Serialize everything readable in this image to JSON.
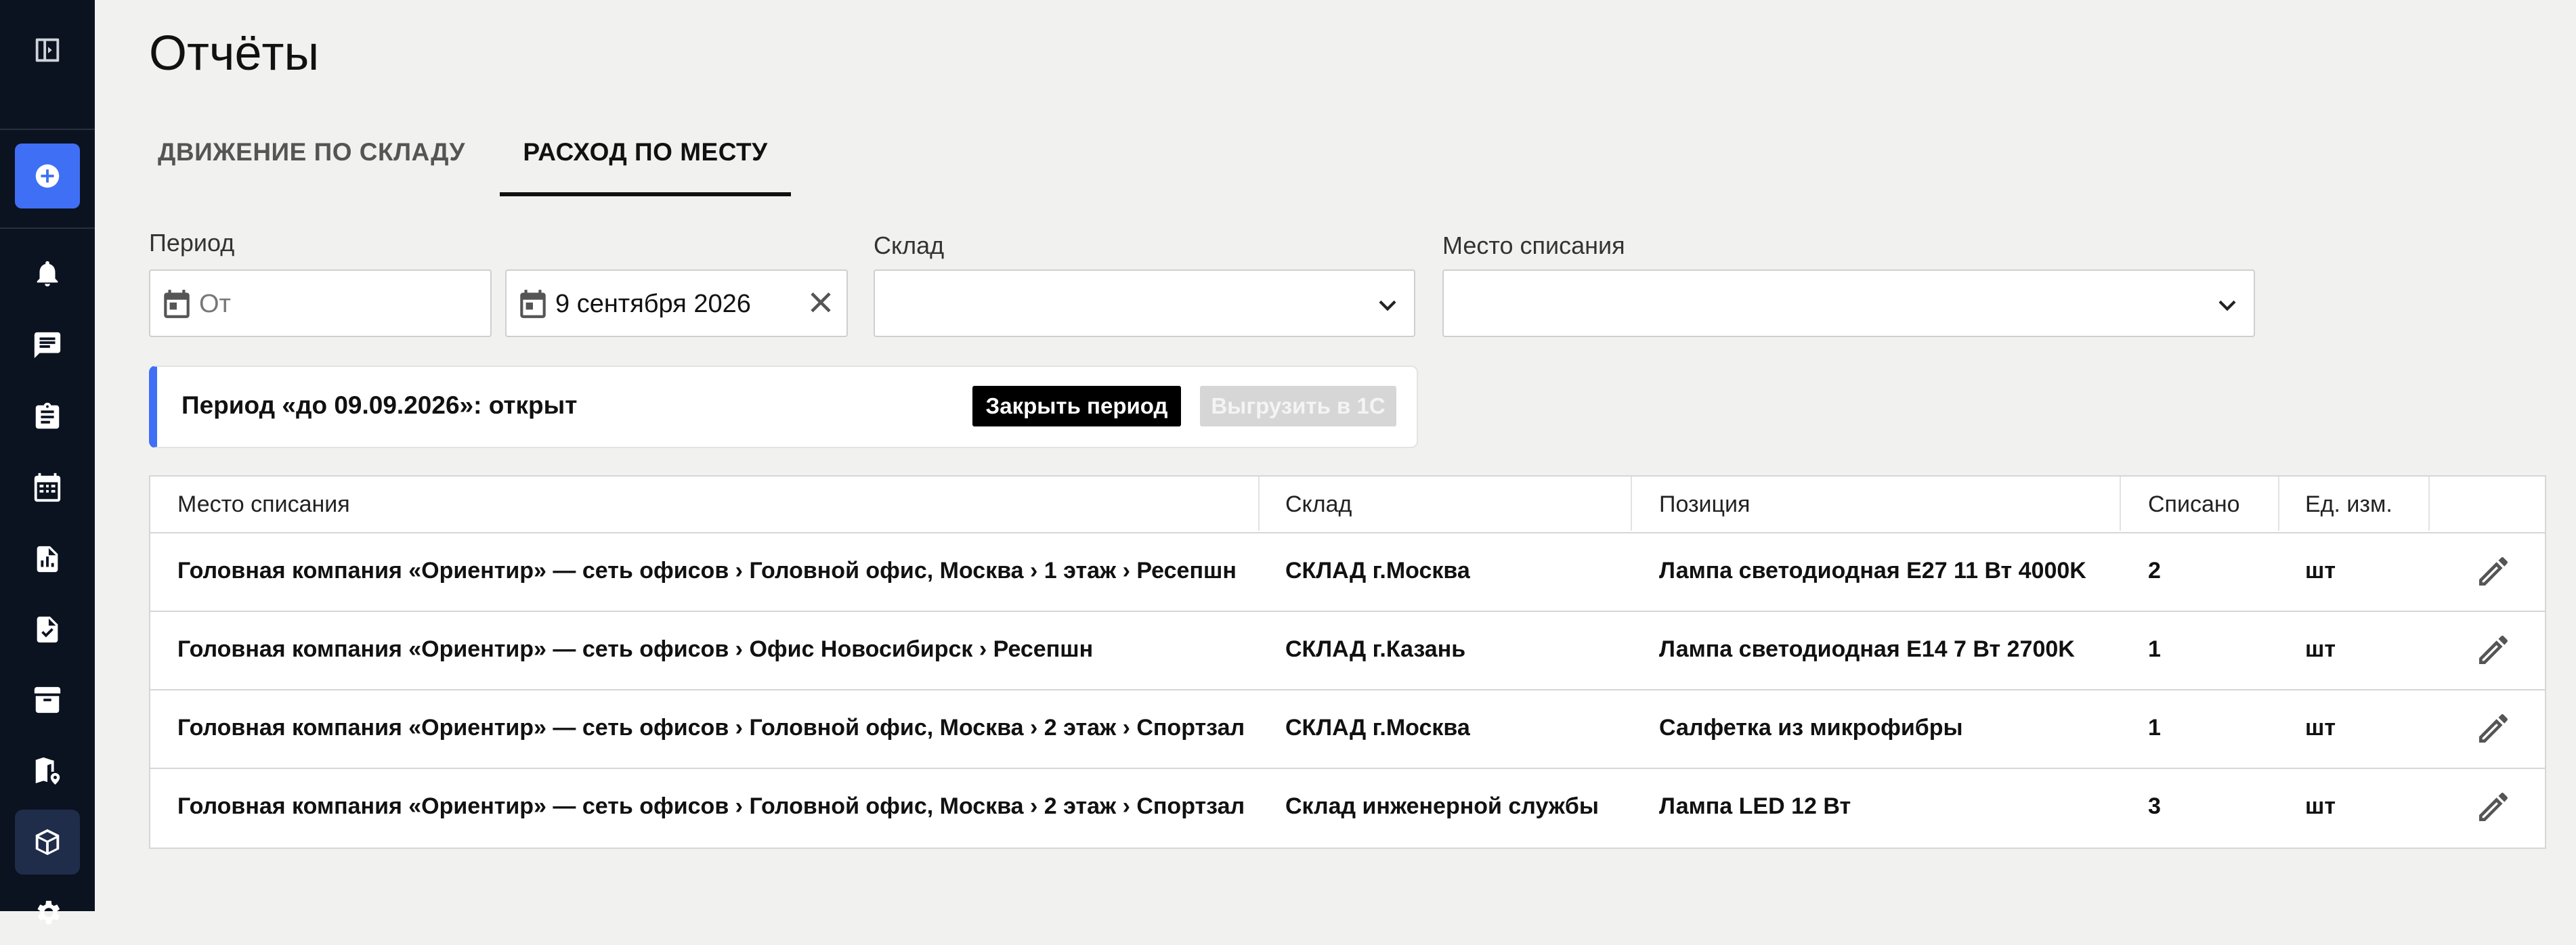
{
  "page": {
    "title": "Отчёты",
    "tabs": [
      {
        "label": "ДВИЖЕНИЕ ПО СКЛАДУ",
        "active": false
      },
      {
        "label": "РАСХОД ПО МЕСТУ",
        "active": true
      }
    ]
  },
  "filters": {
    "period_label": "Период",
    "from_placeholder": "От",
    "to_value": "9 сентября 2026",
    "warehouse_label": "Склад",
    "warehouse_value": "",
    "place_label": "Место списания",
    "place_value": ""
  },
  "banner": {
    "text": "Период «до 09.09.2026»: открыт",
    "close_button": "Закрыть период",
    "export_button": "Выгрузить в 1С",
    "accent_color": "#3f6ff5"
  },
  "table": {
    "headers": [
      "Место списания",
      "Склад",
      "Позиция",
      "Списано",
      "Ед. изм."
    ],
    "rows": [
      {
        "place": "Головная компания «Ориентир» — сеть офисов › Головной офис, Москва › 1 этаж › Ресепшн",
        "warehouse": "СКЛАД г.Москва",
        "item": "Лампа светодиодная E27 11 Вт 4000K",
        "qty": "2",
        "unit": "шт"
      },
      {
        "place": "Головная компания «Ориентир» — сеть офисов › Офис Новосибирск › Ресепшн",
        "warehouse": "СКЛАД г.Казань",
        "item": "Лампа светодиодная E14 7 Вт 2700K",
        "qty": "1",
        "unit": "шт"
      },
      {
        "place": "Головная компания «Ориентир» — сеть офисов › Головной офис, Москва › 2 этаж › Спортзал",
        "warehouse": "СКЛАД г.Москва",
        "item": "Салфетка из микрофибры",
        "qty": "1",
        "unit": "шт"
      },
      {
        "place": "Головная компания «Ориентир» — сеть офисов › Головной офис, Москва › 2 этаж › Спортзал",
        "warehouse": "Склад инженерной службы",
        "item": "Лампа LED 12 Вт",
        "qty": "3",
        "unit": "шт"
      }
    ]
  },
  "sidebar": {
    "icons": [
      "panel-toggle-icon",
      "add-icon",
      "bell-icon",
      "chat-icon",
      "clipboard-icon",
      "calendar-icon",
      "report-icon",
      "checklist-icon",
      "archive-icon",
      "map-icon",
      "box-icon",
      "settings-icon"
    ],
    "bg_color": "#0b1220"
  }
}
